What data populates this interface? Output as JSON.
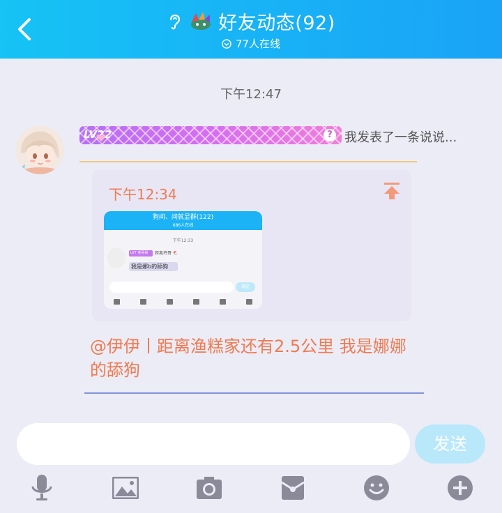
{
  "header": {
    "title": "好友动态(92)",
    "online_text": "77人在线"
  },
  "chat": {
    "timestamp": "下午12:47",
    "sender_level": "LV22",
    "action_text": "我发表了一条说说...",
    "card": {
      "time": "下午12:34",
      "mini_screenshot": {
        "title": "狗间、间就显群(122)",
        "online": "686人在线",
        "time": "下午12:33",
        "lv_tag": "LV7 老哥哥",
        "name_text": "距离鸡哥 🐔",
        "bubble_text": "我是娜b的舔狗",
        "send": "发送"
      }
    },
    "message": "@伊伊丨距离渔糕家还有2.5公里 我是娜娜的舔狗"
  },
  "input": {
    "value": "",
    "placeholder": "",
    "send_label": "发送"
  },
  "toolbar": {
    "icons": [
      "microphone-icon",
      "image-icon",
      "camera-icon",
      "red-packet-icon",
      "emoji-icon",
      "plus-icon"
    ]
  },
  "colors": {
    "header_start": "#16c3f5",
    "header_end": "#1aa3f7",
    "accent_orange": "#f07a50",
    "send_button": "#b9e8fb",
    "background": "#ececf6"
  }
}
